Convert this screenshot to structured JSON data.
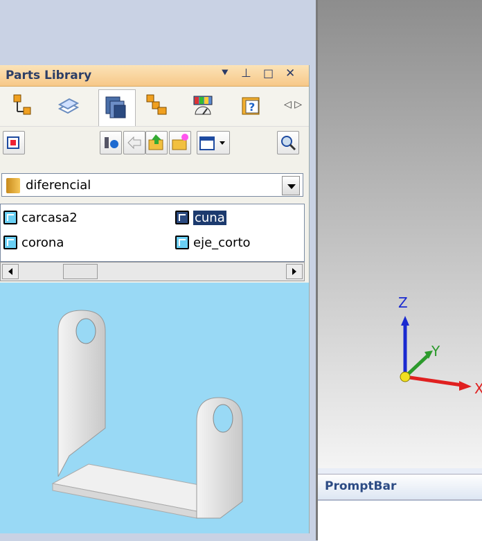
{
  "parts_library": {
    "title": "Parts Library",
    "controls": {
      "pin": "▾",
      "dock": "ᚔ",
      "maximize": "□",
      "close": "✕"
    },
    "tabs": [
      {
        "icon": "assembly-tree-icon"
      },
      {
        "icon": "layers-icon"
      },
      {
        "icon": "parts-library-icon",
        "active": true
      },
      {
        "icon": "family-of-parts-icon"
      },
      {
        "icon": "sensor-icon"
      },
      {
        "icon": "properties-icon"
      }
    ],
    "toolbar": {
      "buttons": [
        "view-icon",
        "insert-part-icon",
        "back-icon",
        "up-folder-icon",
        "new-folder-icon",
        "view-options-icon",
        "search-icon"
      ]
    },
    "folder": {
      "name": "diferencial"
    },
    "files": [
      {
        "name": "carcasa2",
        "selected": false
      },
      {
        "name": "cuna",
        "selected": true
      },
      {
        "name": "corona",
        "selected": false
      },
      {
        "name": "eje_corto",
        "selected": false
      }
    ],
    "preview_bg": "#99d9f5"
  },
  "axes": {
    "z": "Z",
    "y": "Y",
    "x": "X"
  },
  "promptbar": {
    "title": "PromptBar"
  },
  "colors": {
    "title_bg": "#f7c888",
    "selection": "#1c3a6e",
    "preview": "#99d9f5"
  }
}
